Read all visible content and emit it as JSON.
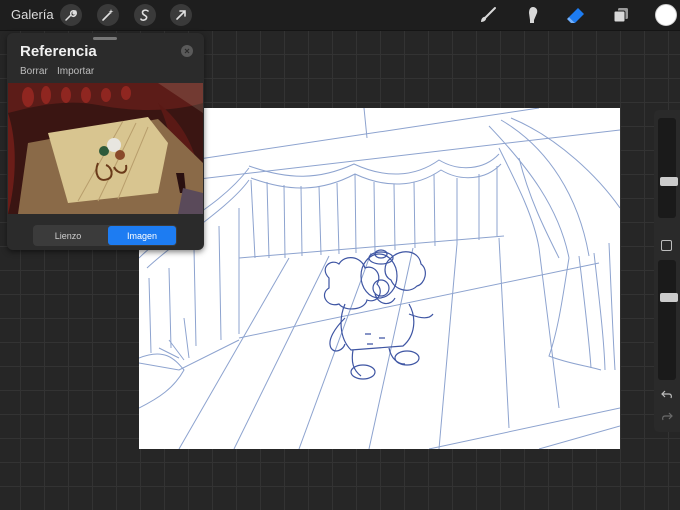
{
  "toolbar": {
    "gallery_label": "Galería",
    "left_icons": [
      "wrench-icon",
      "magic-wand-icon",
      "selection-s-icon",
      "transform-arrow-icon"
    ],
    "right_icons": [
      "brush-icon",
      "smudge-icon",
      "eraser-icon",
      "layers-icon"
    ],
    "active_tool": "eraser",
    "accent_color": "#1d7cf2",
    "current_color": "#ffffff"
  },
  "reference": {
    "title": "Referencia",
    "clear_label": "Borrar",
    "import_label": "Importar",
    "tabs": [
      {
        "label": "Lienzo",
        "active": false
      },
      {
        "label": "Imagen",
        "active": true
      }
    ]
  },
  "sidebar": {
    "brush_size_level": 0.35,
    "opacity_level": 0.7,
    "undo_icon": "undo-icon",
    "redo_icon": "redo-icon"
  }
}
